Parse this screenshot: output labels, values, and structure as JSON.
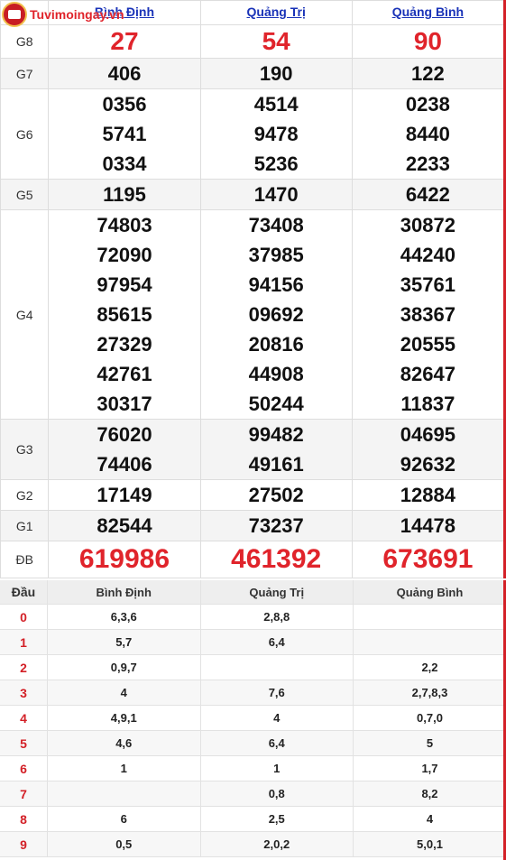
{
  "site": {
    "logo_text": "Tuvimoingay.vn"
  },
  "provinces": [
    "Bình Định",
    "Quảng Trị",
    "Quảng Bình"
  ],
  "prizes": [
    {
      "label": "G8",
      "values": [
        [
          "27"
        ],
        [
          "54"
        ],
        [
          "90"
        ]
      ]
    },
    {
      "label": "G7",
      "values": [
        [
          "406"
        ],
        [
          "190"
        ],
        [
          "122"
        ]
      ]
    },
    {
      "label": "G6",
      "values": [
        [
          "0356",
          "5741",
          "0334"
        ],
        [
          "4514",
          "9478",
          "5236"
        ],
        [
          "0238",
          "8440",
          "2233"
        ]
      ]
    },
    {
      "label": "G5",
      "values": [
        [
          "1195"
        ],
        [
          "1470"
        ],
        [
          "6422"
        ]
      ]
    },
    {
      "label": "G4",
      "values": [
        [
          "74803",
          "72090",
          "97954",
          "85615",
          "27329",
          "42761",
          "30317"
        ],
        [
          "73408",
          "37985",
          "94156",
          "09692",
          "20816",
          "44908",
          "50244"
        ],
        [
          "30872",
          "44240",
          "35761",
          "38367",
          "20555",
          "82647",
          "11837"
        ]
      ]
    },
    {
      "label": "G3",
      "values": [
        [
          "76020",
          "74406"
        ],
        [
          "99482",
          "49161"
        ],
        [
          "04695",
          "92632"
        ]
      ]
    },
    {
      "label": "G2",
      "values": [
        [
          "17149"
        ],
        [
          "27502"
        ],
        [
          "12884"
        ]
      ]
    },
    {
      "label": "G1",
      "values": [
        [
          "82544"
        ],
        [
          "73237"
        ],
        [
          "14478"
        ]
      ]
    },
    {
      "label": "ĐB",
      "values": [
        [
          "619986"
        ],
        [
          "461392"
        ],
        [
          "673691"
        ]
      ]
    }
  ],
  "loto": {
    "head_label": "Đầu",
    "columns": [
      "Bình Định",
      "Quảng Trị",
      "Quảng Bình"
    ],
    "rows": [
      {
        "dau": "0",
        "vals": [
          "6,3,6",
          "2,8,8",
          ""
        ]
      },
      {
        "dau": "1",
        "vals": [
          "5,7",
          "6,4",
          ""
        ]
      },
      {
        "dau": "2",
        "vals": [
          "0,9,7",
          "",
          "2,2"
        ]
      },
      {
        "dau": "3",
        "vals": [
          "4",
          "7,6",
          "2,7,8,3"
        ]
      },
      {
        "dau": "4",
        "vals": [
          "4,9,1",
          "4",
          "0,7,0"
        ]
      },
      {
        "dau": "5",
        "vals": [
          "4,6",
          "6,4",
          "5"
        ]
      },
      {
        "dau": "6",
        "vals": [
          "1",
          "1",
          "1,7"
        ]
      },
      {
        "dau": "7",
        "vals": [
          "",
          "0,8",
          "8,2"
        ]
      },
      {
        "dau": "8",
        "vals": [
          "6",
          "2,5",
          "4"
        ]
      },
      {
        "dau": "9",
        "vals": [
          "0,5",
          "2,0,2",
          "5,0,1"
        ]
      }
    ]
  },
  "colors": {
    "accent_red": "#e0242b",
    "link_blue": "#1a33b8",
    "border_red": "#d32027"
  }
}
